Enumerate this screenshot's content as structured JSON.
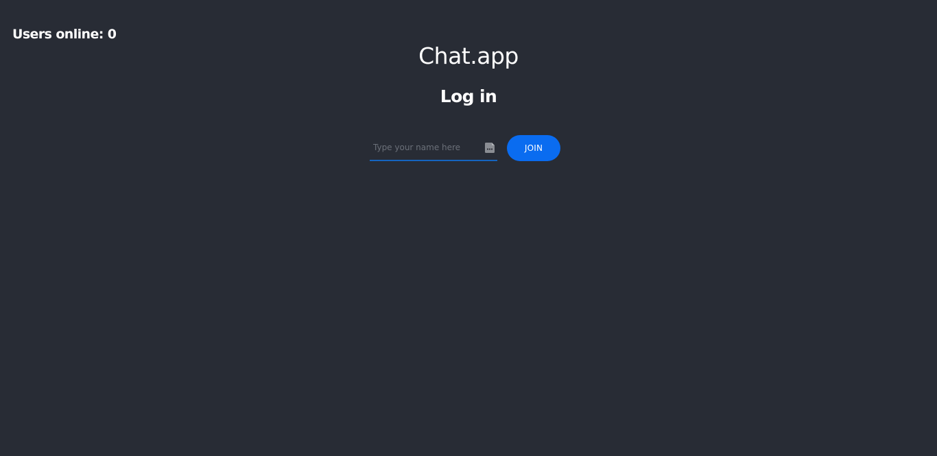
{
  "header": {
    "users_online": "Users online: 0"
  },
  "main": {
    "title": "Chat.app",
    "subtitle": "Log in"
  },
  "login_form": {
    "name_input": {
      "placeholder": "Type your name here",
      "value": ""
    },
    "autofill_icon": "password-manager-icon",
    "join_label": "JOIN"
  },
  "colors": {
    "background": "#282c35",
    "text": "#ffffff",
    "accent": "#0a6cf0",
    "input_underline": "#1565c0",
    "placeholder": "#6b7079"
  }
}
